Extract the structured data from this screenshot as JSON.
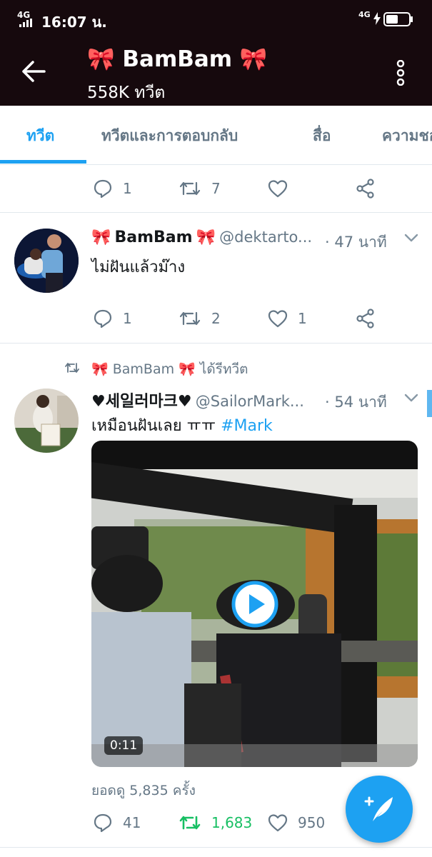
{
  "status_bar": {
    "network": "4G",
    "time": "16:07 น."
  },
  "header": {
    "title": "BamBam",
    "ribbon": "🎀",
    "tweet_count": "558K ทวีต"
  },
  "tabs": [
    {
      "label": "ทวีต",
      "active": true
    },
    {
      "label": "ทวีตและการตอบกลับ",
      "active": false
    },
    {
      "label": "สื่อ",
      "active": false
    },
    {
      "label": "ความชอบ",
      "active": false
    }
  ],
  "tweet0": {
    "replies": "1",
    "retweets": "7",
    "likes": ""
  },
  "tweet1": {
    "name": "BamBam",
    "handle": "@dektarto...",
    "time": "· 47 นาที",
    "text": "ไม่ฝันแล้วม๊าง",
    "replies": "1",
    "retweets": "2",
    "likes": "1"
  },
  "tweet2": {
    "retweeted_by_name": "BamBam",
    "retweeted_suffix": "ได้รีทวีต",
    "name": "♥세일러마크♥",
    "handle": "@SailorMark...",
    "time": "· 54 นาที",
    "text": "เหมือนฝันเลย ㅠㅠ",
    "hashtag": "#Mark",
    "video_duration": "0:11",
    "views": "ยอดดู 5,835 ครั้ง",
    "replies": "41",
    "retweets": "1,683",
    "likes": "950"
  },
  "colors": {
    "header_bg": "#16090d",
    "accent": "#1da1f2",
    "retweet_green": "#17bf63",
    "ribbon_red": "#e0245e"
  }
}
